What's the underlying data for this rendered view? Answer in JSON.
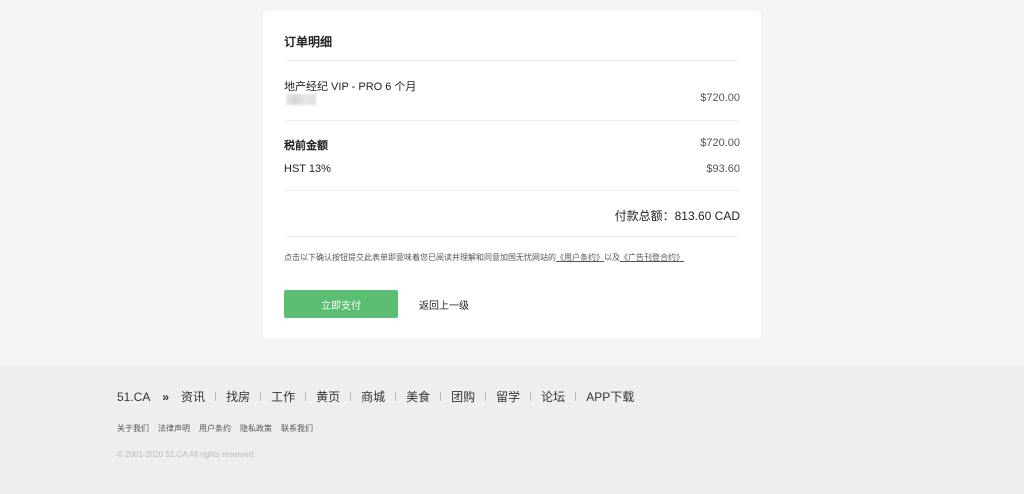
{
  "order": {
    "title": "订单明细",
    "product_name": "地产经纪 VIP - PRO 6 个月",
    "product_amount": "$720.00",
    "subtotal_label": "税前金额",
    "subtotal_amount": "$720.00",
    "tax_label": "HST 13%",
    "tax_amount": "$93.60",
    "total_text": "付款总额：813.60 CAD"
  },
  "agreement": {
    "prefix": "点击以下确认按钮提交此表单即意味着您已阅读并理解和同意加国无忧网站的",
    "terms_link": "《用户条约》",
    "middle": "以及",
    "ad_link": "《广告刊登合约》"
  },
  "actions": {
    "pay_label": "立即支付",
    "back_label": "返回上一级"
  },
  "footer": {
    "brand": "51.CA",
    "arrow": "»",
    "nav": [
      "资讯",
      "找房",
      "工作",
      "黄页",
      "商城",
      "美食",
      "团购",
      "留学",
      "论坛",
      "APP下载"
    ],
    "links": [
      "关于我们",
      "法律声明",
      "用户条约",
      "隐私政策",
      "联系我们"
    ],
    "copyright": "© 2001-2020 51.CA All rights reserved."
  },
  "colors": {
    "pay_button": "#5bbd72",
    "page_bg": "#f4f5f7",
    "footer_bg": "#eeeeee"
  }
}
